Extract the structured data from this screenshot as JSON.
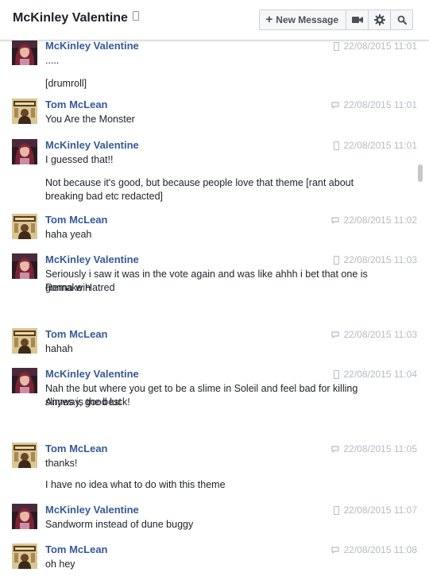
{
  "header": {
    "title": "McKinley Valentine",
    "new_message_label": "New Message",
    "icons": [
      "mobile-icon",
      "video-icon",
      "gear-icon",
      "search-icon"
    ]
  },
  "colors": {
    "name": "#365899",
    "meta": "#b6bac1",
    "text": "#1d2129"
  },
  "messages": [
    {
      "sender": "McKinley Valentine",
      "device": "mobile",
      "time": "22/08/2015 11:01",
      "lines": [
        ".....",
        "[drumroll]"
      ]
    },
    {
      "sender": "Tom McLean",
      "device": "web",
      "time": "22/08/2015 11:01",
      "lines": [
        "You Are the Monster"
      ]
    },
    {
      "sender": "McKinley Valentine",
      "device": "mobile",
      "time": "22/08/2015 11:01",
      "lines": [
        "I guessed that!!",
        "Not because it's good, but because people love that theme [rant about breaking bad etc redacted]"
      ]
    },
    {
      "sender": "Tom McLean",
      "device": "web",
      "time": "22/08/2015 11:02",
      "lines": [
        "haha yeah"
      ]
    },
    {
      "sender": "McKinley Valentine",
      "device": "mobile",
      "time": "22/08/2015 11:03",
      "lines": [
        "Seriously i saw it was in the vote again and was like ahhh i bet that one is gonna win",
        "Remake Hatred"
      ]
    },
    {
      "sender": "Tom McLean",
      "device": "web",
      "time": "22/08/2015 11:03",
      "lines": [
        "hahah"
      ]
    },
    {
      "sender": "McKinley Valentine",
      "device": "mobile",
      "time": "22/08/2015 11:04",
      "lines": [
        "Nah the but where you get to be a slime in Soleil and feel bad for killing slimes is the best",
        "Anyway, good luck!"
      ]
    },
    {
      "sender": "Tom McLean",
      "device": "web",
      "time": "22/08/2015 11:05",
      "lines": [
        "thanks!",
        "I have no idea what to do with this theme"
      ]
    },
    {
      "sender": "McKinley Valentine",
      "device": "mobile",
      "time": "22/08/2015 11:07",
      "lines": [
        "Sandworm instead of dune buggy"
      ]
    },
    {
      "sender": "Tom McLean",
      "device": "web",
      "time": "22/08/2015 11:08",
      "lines": [
        "oh hey"
      ]
    }
  ]
}
